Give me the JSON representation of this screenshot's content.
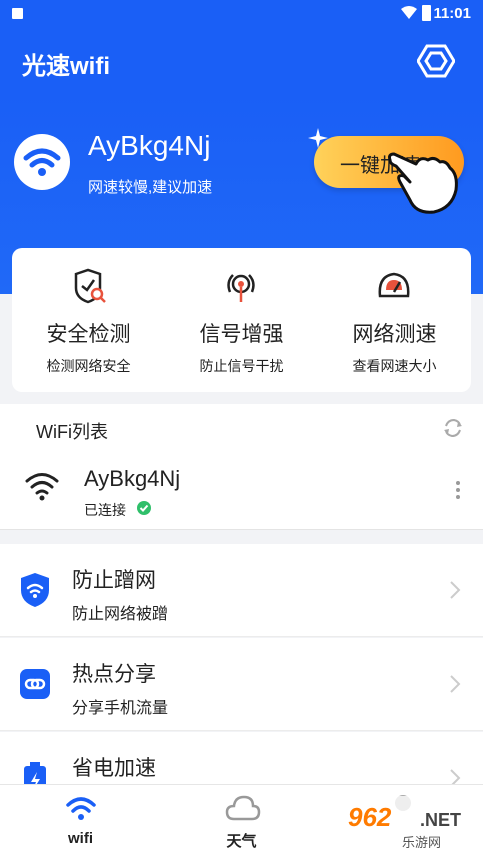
{
  "status_bar": {
    "time": "11:01"
  },
  "app_bar": {
    "title": "光速wifi",
    "settings_icon": "hexagon-icon"
  },
  "hero": {
    "ssid": "AyBkg4Nj",
    "hint": "网速较慢,建议加速",
    "boost_label": "一键加速",
    "accent": "#1a5ff6"
  },
  "tools": [
    {
      "icon": "shield-check-icon",
      "name": "安全检测",
      "sub": "检测网络安全"
    },
    {
      "icon": "signal-antenna-icon",
      "name": "信号增强",
      "sub": "防止信号干扰"
    },
    {
      "icon": "speedometer-icon",
      "name": "网络测速",
      "sub": "查看网速大小"
    }
  ],
  "wifi_list": {
    "heading": "WiFi列表",
    "network": {
      "ssid": "AyBkg4Nj",
      "status": "已连接"
    }
  },
  "features": [
    {
      "icon": "shield-wifi-icon",
      "name": "防止蹭网",
      "sub": "防止网络被蹭"
    },
    {
      "icon": "hotspot-link-icon",
      "name": "热点分享",
      "sub": "分享手机流量"
    },
    {
      "icon": "battery-save-icon",
      "name": "省电加速",
      "sub": ""
    }
  ],
  "tabbar": [
    {
      "label": "wifi",
      "icon": "wifi-icon"
    },
    {
      "label": "天气",
      "icon": "cloud-icon"
    },
    {
      "label": "",
      "icon": "profile-icon"
    }
  ],
  "watermark": {
    "num": "962",
    "net": ".NET",
    "cn": "乐游网"
  }
}
